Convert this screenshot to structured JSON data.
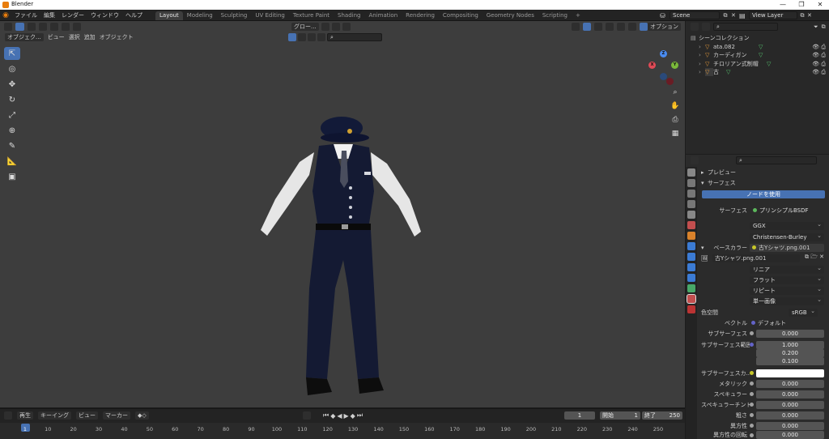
{
  "window": {
    "title": "Blender",
    "controls": [
      "—",
      "❐",
      "✕"
    ]
  },
  "menu": [
    "ファイル",
    "編集",
    "レンダー",
    "ウィンドウ",
    "ヘルプ"
  ],
  "workspaces": [
    "Layout",
    "Modeling",
    "Sculpting",
    "UV Editing",
    "Texture Paint",
    "Shading",
    "Animation",
    "Rendering",
    "Compositing",
    "Geometry Nodes",
    "Scripting"
  ],
  "scene": {
    "name": "Scene",
    "view_layer": "View Layer"
  },
  "viewport_header": {
    "mode": "オブジェク...",
    "menus": [
      "ビュー",
      "選択",
      "追加",
      "オブジェクト"
    ],
    "orientation": "グロー...",
    "options": "オプション"
  },
  "outliner": {
    "root": "シーンコレクション",
    "items": [
      {
        "name": "ata.082"
      },
      {
        "name": "カーディガン"
      },
      {
        "name": "チロリアン式制帽"
      },
      {
        "name": "古"
      }
    ]
  },
  "properties": {
    "panels": {
      "preview": "プレビュー",
      "surface": "サーフェス"
    },
    "use_nodes": "ノードを使用",
    "surface_label": "サーフェス",
    "surface_value": "プリンシプルBSDF",
    "distribution": "GGX",
    "subsurface_method": "Christensen-Burley",
    "base_color_label": "ベースカラー",
    "base_color_value": "古Yシャツ.png.001",
    "image_name": "古Yシャツ.png.001",
    "interpolation": "リニア",
    "projection": "フラット",
    "extension": "リピート",
    "source": "単一画像",
    "colorspace_label": "色空間",
    "colorspace_value": "sRGB",
    "vector_label": "ベクトル",
    "vector_value": "デフォルト",
    "subsurface_label": "サブサーフェス",
    "subsurface_value": "0.000",
    "subsurface_radius_label": "サブサーフェス範囲",
    "subsurface_radius": [
      "1.000",
      "0.200",
      "0.100"
    ],
    "subsurface_color_label": "サブサーフェスカ...",
    "metallic_label": "メタリック",
    "metallic_value": "0.000",
    "specular_label": "スペキュラー",
    "specular_value": "0.000",
    "specular_tint_label": "スペキュラーチント",
    "specular_tint_value": "0.000",
    "roughness_label": "粗さ",
    "roughness_value": "0.000",
    "anisotropic_label": "異方性",
    "anisotropic_value": "0.000",
    "anisotropic_rotation_label": "異方性の回転",
    "anisotropic_rotation_value": "0.000"
  },
  "timeline": {
    "menus": [
      "再生",
      "キーイング",
      "ビュー",
      "マーカー"
    ],
    "current_frame": "1",
    "start_label": "開始",
    "start": "1",
    "end_label": "終了",
    "end": "250",
    "ticks": [
      "1",
      "10",
      "20",
      "30",
      "40",
      "50",
      "60",
      "70",
      "80",
      "90",
      "100",
      "110",
      "120",
      "130",
      "140",
      "150",
      "160",
      "170",
      "180",
      "190",
      "200",
      "210",
      "220",
      "230",
      "240",
      "250"
    ]
  },
  "colors": {
    "accent": "#4772b3",
    "viewport_bg": "#3d3d3d",
    "uniform_navy": "#141a33"
  }
}
